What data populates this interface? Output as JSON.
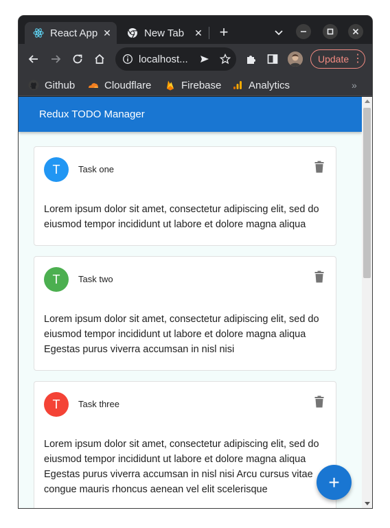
{
  "browser": {
    "tabs": [
      {
        "title": "React App",
        "icon": "react-icon",
        "active": true
      },
      {
        "title": "New Tab",
        "icon": "chrome-icon",
        "active": false
      }
    ],
    "address": "localhost...",
    "update_label": "Update",
    "bookmarks": [
      {
        "label": "Github",
        "icon": "github-icon"
      },
      {
        "label": "Cloudflare",
        "icon": "cloudflare-icon"
      },
      {
        "label": "Firebase",
        "icon": "firebase-icon"
      },
      {
        "label": "Analytics",
        "icon": "analytics-icon"
      }
    ],
    "bookmarks_overflow": "»"
  },
  "app": {
    "title": "Redux TODO Manager",
    "header_color": "#1976d2",
    "fab_label": "+",
    "tasks": [
      {
        "avatar": "T",
        "avatar_color": "#2196f3",
        "title": "Task one",
        "body": "Lorem ipsum dolor sit amet, consectetur adipiscing elit, sed do eiusmod tempor incididunt ut labore et dolore magna aliqua"
      },
      {
        "avatar": "T",
        "avatar_color": "#4caf50",
        "title": "Task two",
        "body": "Lorem ipsum dolor sit amet, consectetur adipiscing elit, sed do eiusmod tempor incididunt ut labore et dolore magna aliqua Egestas purus viverra accumsan in nisl nisi"
      },
      {
        "avatar": "T",
        "avatar_color": "#f44336",
        "title": "Task three",
        "body": "Lorem ipsum dolor sit amet, consectetur adipiscing elit, sed do eiusmod tempor incididunt ut labore et dolore magna aliqua Egestas purus viverra accumsan in nisl nisi Arcu cursus vitae congue mauris rhoncus aenean vel elit scelerisque"
      }
    ]
  }
}
